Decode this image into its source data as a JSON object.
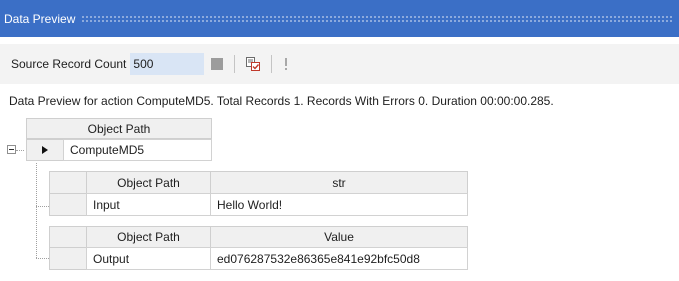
{
  "titlebar": {
    "title": "Data Preview"
  },
  "toolbar": {
    "source_label": "Source Record Count",
    "source_value": "500"
  },
  "status_text": "Data Preview for action ComputeMD5. Total Records 1. Records With Errors 0. Duration 00:00:00.285.",
  "root_grid": {
    "header": "Object Path",
    "row": {
      "object_path": "ComputeMD5"
    }
  },
  "input_grid": {
    "headers": [
      "Object Path",
      "str"
    ],
    "row": {
      "object_path": "Input",
      "value": "Hello World!"
    }
  },
  "output_grid": {
    "headers": [
      "Object Path",
      "Value"
    ],
    "row": {
      "object_path": "Output",
      "value": "ed076287532e86365e841e92bfc50d8"
    }
  }
}
